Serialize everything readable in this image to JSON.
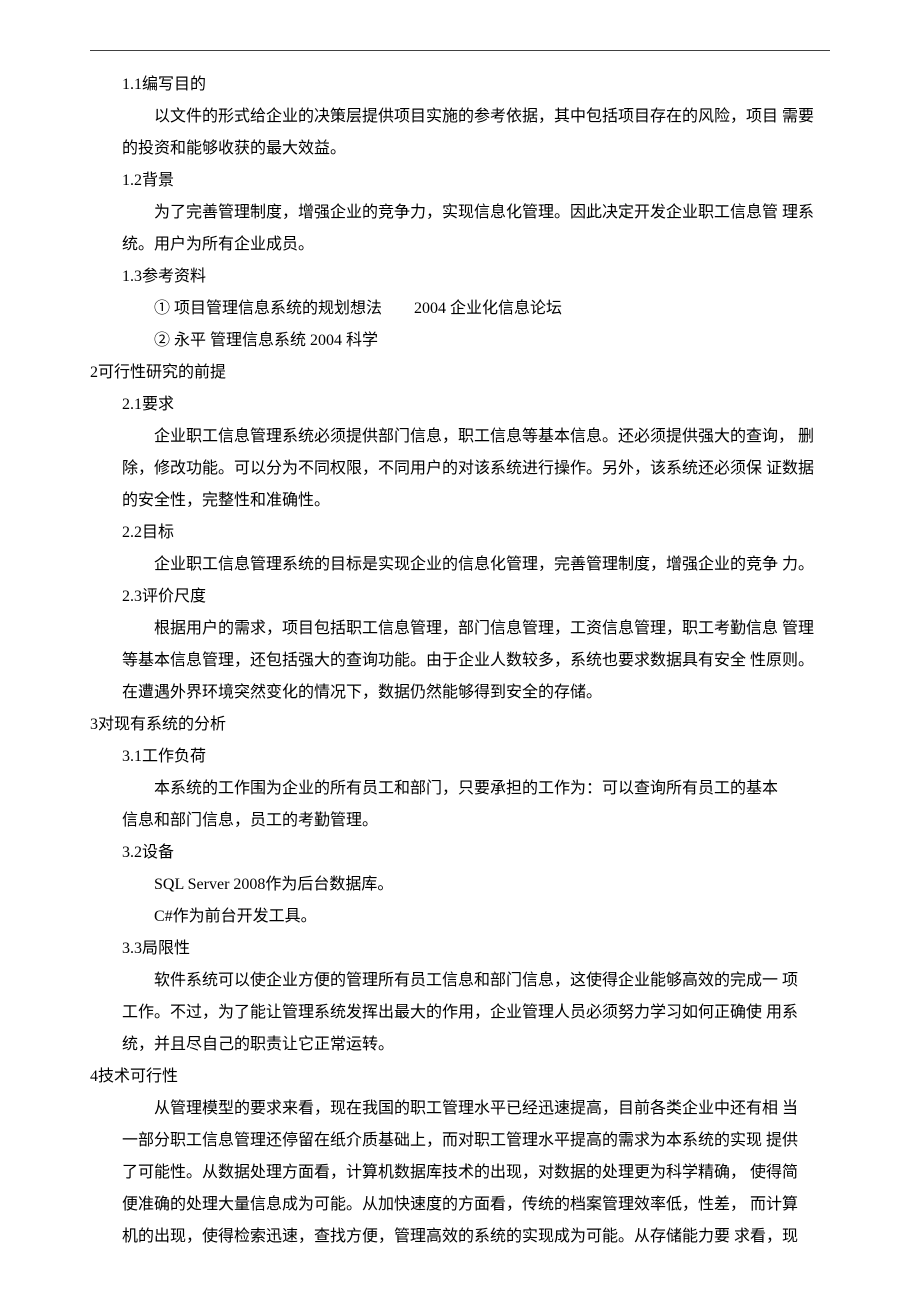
{
  "sections": {
    "s1_1": {
      "heading": "1.1编写目的",
      "p1_line1": "以文件的形式给企业的决策层提供项目实施的参考依据，其中包括项目存在的风险，项目 需要",
      "p1_line2": "的投资和能够收获的最大效益。"
    },
    "s1_2": {
      "heading": "1.2背景",
      "p1_line1": "为了完善管理制度，增强企业的竞争力，实现信息化管理。因此决定开发企业职工信息管 理系",
      "p1_line2": "统。用户为所有企业成员。"
    },
    "s1_3": {
      "heading": "1.3参考资料",
      "ref1": "① 项目管理信息系统的规划想法　　2004 企业化信息论坛",
      "ref2": "② 永平 管理信息系统 2004 科学"
    },
    "s2": {
      "heading": "2可行性研究的前提"
    },
    "s2_1": {
      "heading": "2.1要求",
      "p1_line1": "企业职工信息管理系统必须提供部门信息，职工信息等基本信息。还必须提供强大的查询， 删",
      "p1_line2": "除，修改功能。可以分为不同权限，不同用户的对该系统进行操作。另外，该系统还必须保 证数据",
      "p1_line3": "的安全性，完整性和准确性。"
    },
    "s2_2": {
      "heading": "2.2目标",
      "p1": "企业职工信息管理系统的目标是实现企业的信息化管理，完善管理制度，增强企业的竞争 力。"
    },
    "s2_3": {
      "heading": "2.3评价尺度",
      "p1_line1": "根据用户的需求，项目包括职工信息管理，部门信息管理，工资信息管理，职工考勤信息 管理",
      "p1_line2": "等基本信息管理，还包括强大的查询功能。由于企业人数较多，系统也要求数据具有安全 性原则。",
      "p1_line3": "在遭遇外界环境突然变化的情况下，数据仍然能够得到安全的存储。"
    },
    "s3": {
      "heading": "3对现有系统的分析"
    },
    "s3_1": {
      "heading": "3.1工作负荷",
      "p1_line1": "本系统的工作围为企业的所有员工和部门，只要承担的工作为：可以查询所有员工的基本",
      "p1_line2": "信息和部门信息，员工的考勤管理。"
    },
    "s3_2": {
      "heading": "3.2设备",
      "p1": "SQL Server 2008作为后台数据库。",
      "p2": "C#作为前台开发工具。"
    },
    "s3_3": {
      "heading": "3.3局限性",
      "p1_line1": "软件系统可以使企业方便的管理所有员工信息和部门信息，这使得企业能够高效的完成一 项",
      "p1_line2": "工作。不过，为了能让管理系统发挥出最大的作用，企业管理人员必须努力学习如何正确使 用系",
      "p1_line3": "统，并且尽自己的职责让它正常运转。"
    },
    "s4": {
      "heading": "4技术可行性",
      "p1_line1": "从管理模型的要求来看，现在我国的职工管理水平已经迅速提高，目前各类企业中还有相 当",
      "p1_line2": "一部分职工信息管理还停留在纸介质基础上，而对职工管理水平提高的需求为本系统的实现 提供",
      "p1_line3": "了可能性。从数据处理方面看，计算机数据库技术的出现，对数据的处理更为科学精确， 使得简",
      "p1_line4": "便准确的处理大量信息成为可能。从加快速度的方面看，传统的档案管理效率低，性差， 而计算",
      "p1_line5": "机的出现，使得检索迅速，查找方便，管理高效的系统的实现成为可能。从存储能力要 求看，现"
    }
  }
}
